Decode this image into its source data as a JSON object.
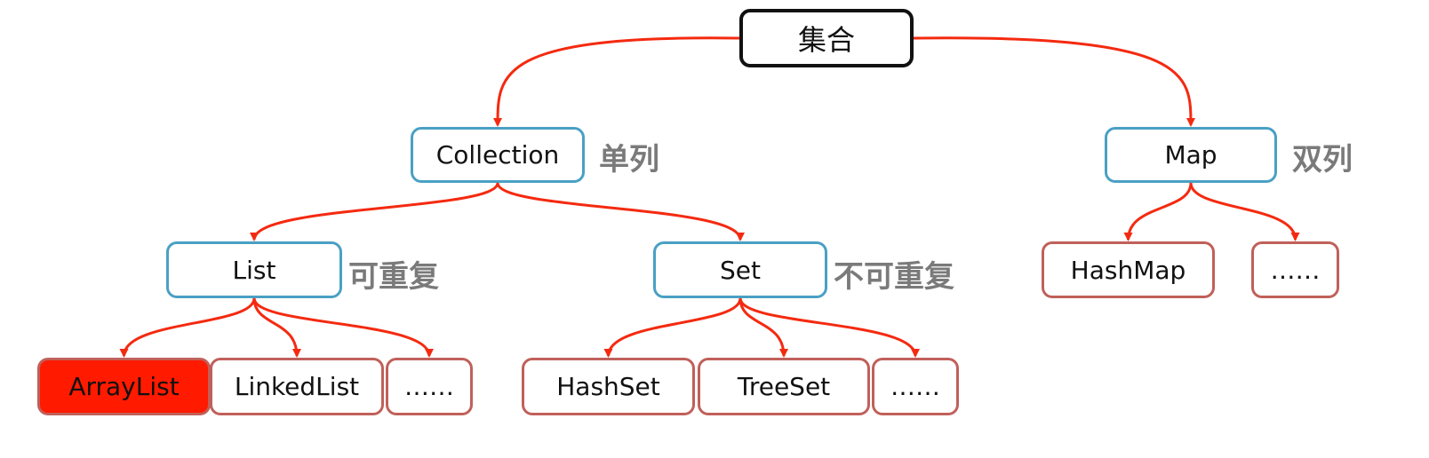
{
  "diagram": {
    "nodes": {
      "root": "集合",
      "collection": "Collection",
      "map": "Map",
      "list": "List",
      "set": "Set",
      "hashmap": "HashMap",
      "map_more": "……",
      "arraylist": "ArrayList",
      "linkedlist": "LinkedList",
      "list_more": "……",
      "hashset": "HashSet",
      "treeset": "TreeSet",
      "set_more": "……"
    },
    "notes": {
      "collection": "单列",
      "map": "双列",
      "list": "可重复",
      "set": "不可重复"
    },
    "edges": [
      [
        "root",
        "collection"
      ],
      [
        "root",
        "map"
      ],
      [
        "collection",
        "list"
      ],
      [
        "collection",
        "set"
      ],
      [
        "map",
        "hashmap"
      ],
      [
        "map",
        "map_more"
      ],
      [
        "list",
        "arraylist"
      ],
      [
        "list",
        "linkedlist"
      ],
      [
        "list",
        "list_more"
      ],
      [
        "set",
        "hashset"
      ],
      [
        "set",
        "treeset"
      ],
      [
        "set",
        "set_more"
      ]
    ],
    "highlighted": "arraylist",
    "colors": {
      "edge": "#f42a10",
      "highlight": "#ff1a00",
      "interface_border": "#4aa0c4",
      "impl_border": "#c0605a",
      "root_border": "#111111",
      "note": "#7a7a7a"
    }
  }
}
